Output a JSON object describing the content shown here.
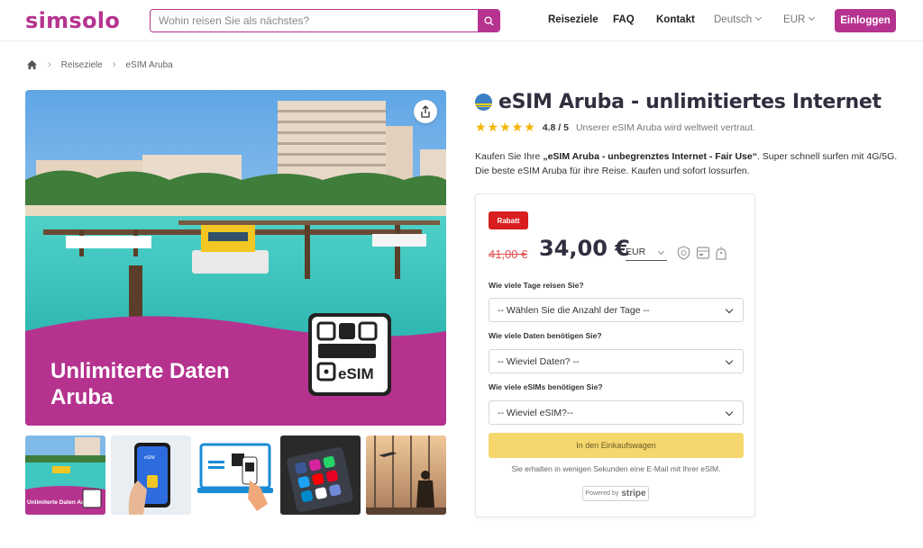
{
  "header": {
    "logo": "simsolo",
    "search_placeholder": "Wohin reisen Sie als nächstes?",
    "nav": [
      "Reiseziele",
      "FAQ",
      "Kontakt"
    ],
    "language": "Deutsch",
    "currency": "EUR",
    "login": "Einloggen"
  },
  "breadcrumb": [
    "Reiseziele",
    "eSIM Aruba"
  ],
  "hero": {
    "overlay_line1": "Unlimiterte Daten",
    "overlay_line2": "Aruba",
    "esim_label": "eSIM"
  },
  "thumbnails": [
    {
      "caption": "Unlimiterte Daten Aruba"
    },
    {
      "caption": "eSIM"
    },
    {
      "caption": ""
    },
    {
      "caption": ""
    },
    {
      "caption": ""
    }
  ],
  "product": {
    "title": "eSIM Aruba - unlimitiertes Internet",
    "stars": "★★★★★",
    "rating": "4.8 / 5",
    "trust": "Unserer eSIM Aruba wird weltweit vertraut.",
    "desc_prefix": "Kaufen Sie Ihre ",
    "desc_bold": "„eSIM Aruba - unbegrenztes Internet - Fair Use“",
    "desc_suffix": ". Super schnell surfen mit 4G/5G. Die beste eSIM Aruba für ihre Reise. Kaufen und sofort lossurfen."
  },
  "purchase": {
    "badge": "Rabatt",
    "old_price": "41,00 €",
    "price": "34,00 €",
    "currency": "EUR",
    "q_days": "Wie viele Tage reisen Sie?",
    "sel_days": "-- Wählen Sie die Anzahl der Tage --",
    "q_data": "Wie viele Daten benötigen Sie?",
    "sel_data": "-- Wieviel Daten? --",
    "q_esims": "Wie viele eSIMs benötigen Sie?",
    "sel_esims": "-- Wieviel eSIM?--",
    "cart": "In den Einkaufswagen",
    "email_note": "Sie erhalten in wenigen Sekunden eine E-Mail mit Ihrer eSIM.",
    "stripe_prefix": "Powered by",
    "stripe_brand": "stripe"
  },
  "colors": {
    "brand": "#b5338f",
    "discount": "#d81e1e",
    "cart": "#f5d76e",
    "stars": "#f4b400"
  }
}
